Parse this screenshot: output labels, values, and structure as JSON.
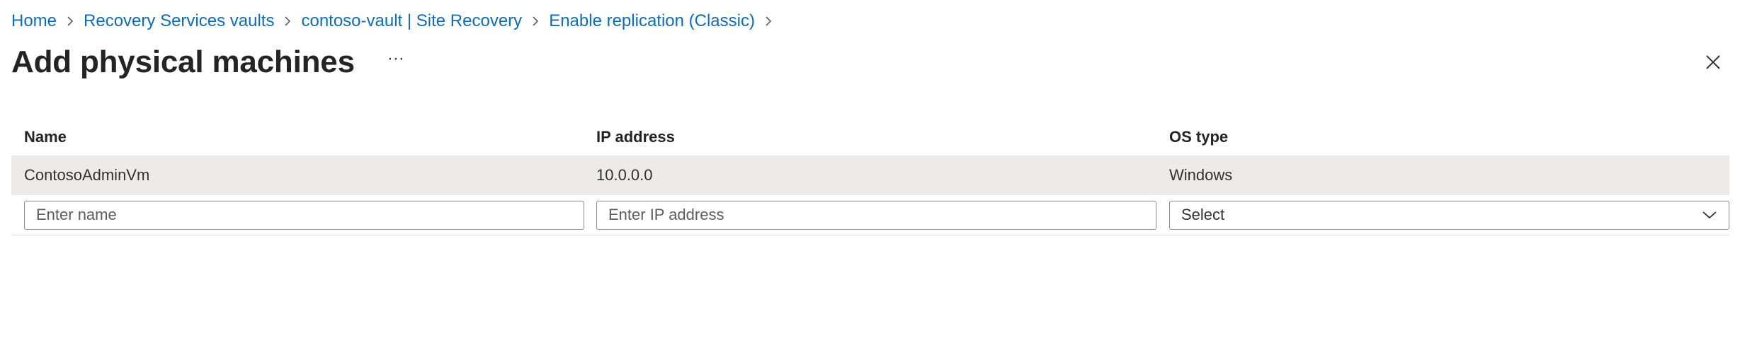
{
  "breadcrumb": {
    "items": [
      {
        "label": "Home"
      },
      {
        "label": "Recovery Services vaults"
      },
      {
        "label": "contoso-vault | Site Recovery"
      },
      {
        "label": "Enable replication (Classic)"
      }
    ],
    "separator_icon": "chevron-right-icon"
  },
  "header": {
    "title": "Add physical machines",
    "more_label": "···",
    "more_icon": "ellipsis-icon",
    "close_icon": "close-icon"
  },
  "table": {
    "columns": [
      "Name",
      "IP address",
      "OS type"
    ],
    "rows": [
      {
        "name": "ContosoAdminVm",
        "ip": "10.0.0.0",
        "os": "Windows"
      }
    ],
    "new_row": {
      "name_placeholder": "Enter name",
      "ip_placeholder": "Enter IP address",
      "os_selected": "Select",
      "os_dropdown_icon": "chevron-down-icon"
    }
  },
  "colors": {
    "link": "#0f6cbd",
    "row_highlight": "#edebe9",
    "input_border": "#8a8886"
  }
}
